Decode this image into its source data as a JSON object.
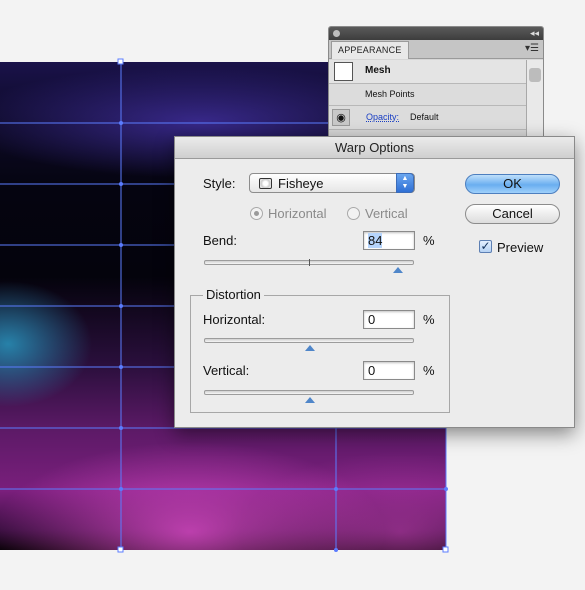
{
  "appearance_panel": {
    "tab_label": "APPEARANCE",
    "collapse_icon": "double-chevron-icon",
    "menu_icon": "panel-menu-icon",
    "rows": {
      "object_label": "Mesh",
      "sub_label": "Mesh Points",
      "opacity_link": "Opacity:",
      "opacity_value": "Default"
    }
  },
  "warp_dialog": {
    "title": "Warp Options",
    "style": {
      "label": "Style:",
      "value": "Fisheye",
      "icon": "fisheye-warp-icon"
    },
    "orientation": {
      "horizontal_label": "Horizontal",
      "vertical_label": "Vertical",
      "selected": "Horizontal",
      "enabled": false
    },
    "bend": {
      "label": "Bend:",
      "value": "84",
      "unit": "%",
      "slider_percent": 84
    },
    "distortion": {
      "group_label": "Distortion",
      "horizontal_label": "Horizontal:",
      "horizontal_value": "0",
      "horizontal_unit": "%",
      "horizontal_slider_percent": 0,
      "vertical_label": "Vertical:",
      "vertical_value": "0",
      "vertical_unit": "%",
      "vertical_slider_percent": 0
    },
    "buttons": {
      "ok_label": "OK",
      "cancel_label": "Cancel"
    },
    "preview": {
      "label": "Preview",
      "checked": true
    }
  },
  "colors": {
    "mesh_line": "#5b7cff",
    "accent_blue": "#4f86c9",
    "artwork_magenta": "#8a2a8c",
    "artwork_dark": "#05040f"
  }
}
